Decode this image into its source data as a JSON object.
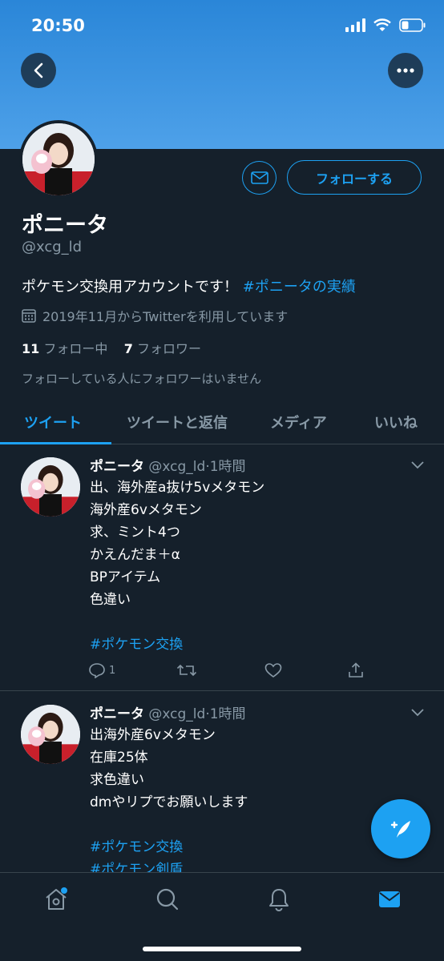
{
  "status_bar": {
    "time": "20:50"
  },
  "profile": {
    "name": "ポニータ",
    "handle": "@xcg_ld",
    "follow_label": "フォローする",
    "bio_text": "ポケモン交換用アカウントです！",
    "bio_hashtag": "#ポニータの実績",
    "joined": "2019年11月からTwitterを利用しています",
    "following_count": "11",
    "following_label": "フォロー中",
    "followers_count": "7",
    "followers_label": "フォロワー",
    "no_followers_note": "フォローしている人にフォロワーはいません"
  },
  "tabs": [
    {
      "label": "ツイート",
      "active": true
    },
    {
      "label": "ツイートと返信",
      "active": false
    },
    {
      "label": "メディア",
      "active": false
    },
    {
      "label": "いいね",
      "active": false
    }
  ],
  "tweets": [
    {
      "name": "ポニータ",
      "meta": "@xcg_ld·1時間",
      "lines": [
        "出、海外産a抜け5vメタモン",
        "海外産6vメタモン",
        "求、ミント4つ",
        "かえんだま＋α",
        "BPアイテム",
        "色違い"
      ],
      "hashtags": [
        "#ポケモン交換"
      ],
      "reply_count": "1"
    },
    {
      "name": "ポニータ",
      "meta": "@xcg_ld·1時間",
      "lines": [
        "出海外産6vメタモン",
        "在庫25体",
        "求色違い",
        "dmやリプでお願いします"
      ],
      "hashtags": [
        "#ポケモン交換",
        "#ポケモン剣盾"
      ]
    }
  ],
  "colors": {
    "accent": "#1da1f2",
    "background": "#15202b",
    "muted": "#8899a6",
    "divider": "#38444d"
  },
  "icons": [
    "back-arrow-icon",
    "more-icon",
    "mail-icon",
    "calendar-icon",
    "chevron-down-icon",
    "reply-icon",
    "retweet-icon",
    "like-icon",
    "share-icon",
    "compose-icon",
    "home-icon",
    "search-icon",
    "notifications-icon",
    "messages-icon"
  ]
}
